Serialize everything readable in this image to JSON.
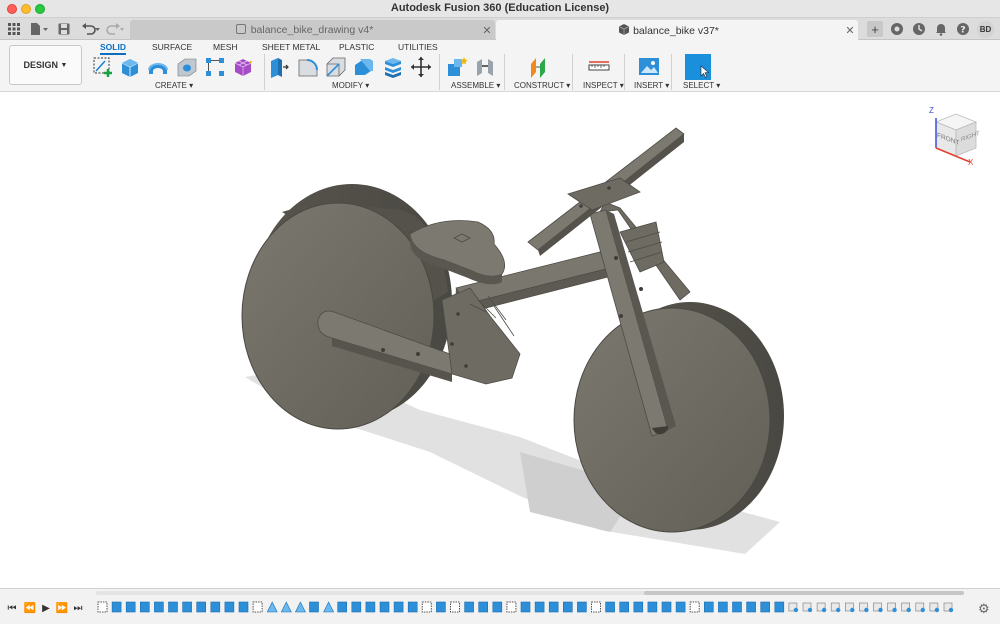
{
  "window": {
    "title": "Autodesk Fusion 360 (Education License)"
  },
  "tabs": [
    {
      "label": "balance_bike_drawing v4*",
      "active": false,
      "icon": "drawing-doc-icon"
    },
    {
      "label": "balance_bike v37*",
      "active": true,
      "icon": "3d-model-doc-icon"
    }
  ],
  "user": {
    "initials": "BD"
  },
  "ribbon": {
    "workspace_label": "DESIGN",
    "tabs": [
      "SOLID",
      "SURFACE",
      "MESH",
      "SHEET METAL",
      "PLASTIC",
      "UTILITIES"
    ],
    "active_tab": "SOLID",
    "groups": [
      "CREATE",
      "MODIFY",
      "ASSEMBLE",
      "CONSTRUCT",
      "INSPECT",
      "INSERT",
      "SELECT"
    ]
  },
  "viewcube": {
    "face_label": "FRONT",
    "side_label": "RIGHT",
    "axis_z": "Z",
    "axis_x": "X"
  },
  "colors": {
    "accent": "#0a6fc2",
    "model_body": "#6e6b63",
    "select_tool": "#1a8fdc"
  }
}
